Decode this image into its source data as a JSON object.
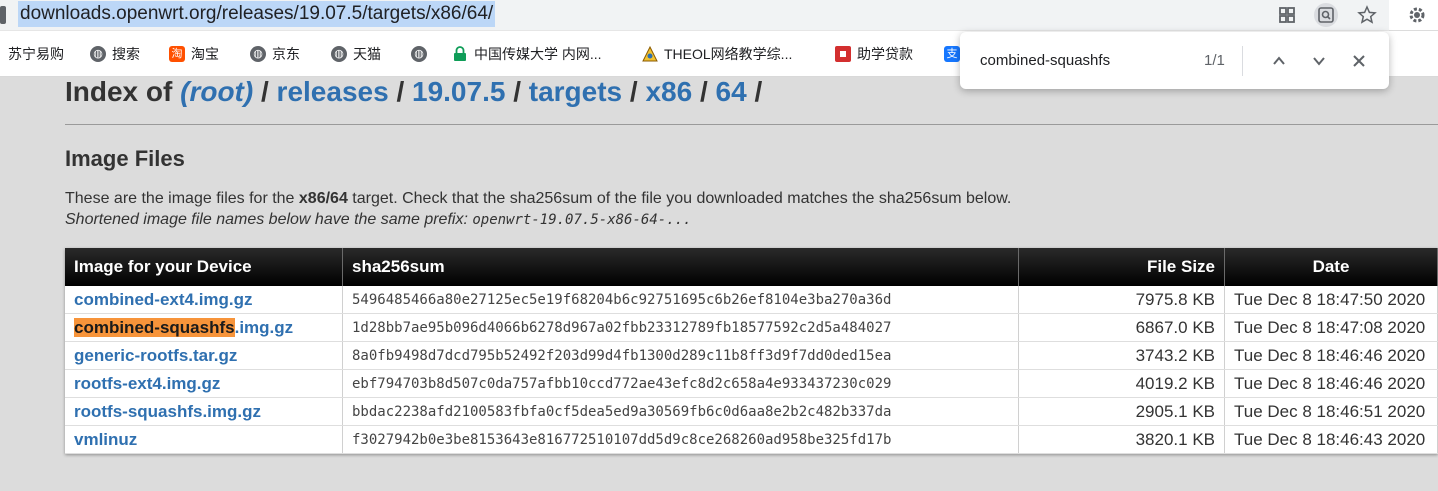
{
  "browser": {
    "url": "downloads.openwrt.org/releases/19.07.5/targets/x86/64/",
    "icons": [
      "apps-grid-icon",
      "lens-icon",
      "star-icon",
      "settings-gear-icon"
    ]
  },
  "bookmarks": [
    {
      "label": "苏宁易购",
      "icon": "none"
    },
    {
      "label": "搜索",
      "icon": "globe-icon"
    },
    {
      "label": "淘宝",
      "icon": "taobao-icon"
    },
    {
      "label": "京东",
      "icon": "globe-icon"
    },
    {
      "label": "天猫",
      "icon": "globe-icon"
    },
    {
      "label": "",
      "icon": "globe-icon"
    },
    {
      "label": "中国传媒大学 内网...",
      "icon": "lock-icon"
    },
    {
      "label": "THEOL网络教学综...",
      "icon": "theol-icon"
    },
    {
      "label": "助学贷款",
      "icon": "loan-icon"
    }
  ],
  "page": {
    "index_prefix": "Index of",
    "breadcrumb": [
      "(root)",
      "releases",
      "19.07.5",
      "targets",
      "x86",
      "64"
    ],
    "separator": "/",
    "section_title": "Image Files",
    "desc_part1": "These are the image files for the ",
    "desc_target": "x86/64",
    "desc_part2": " target. Check that the sha256sum of the file you downloaded matches the sha256sum below.",
    "prefix_note": "Shortened image file names below have the same prefix: ",
    "prefix_value": "openwrt-19.07.5-x86-64-..."
  },
  "table": {
    "headers": [
      "Image for your Device",
      "sha256sum",
      "File Size",
      "Date"
    ],
    "rows": [
      {
        "name": "combined-ext4.img.gz",
        "sha": "5496485466a80e27125ec5e19f68204b6c92751695c6b26ef8104e3ba270a36d",
        "size": "7975.8 KB",
        "date": "Tue Dec 8 18:47:50 2020"
      },
      {
        "name_highlight": "combined-squashfs",
        "name_rest": ".img.gz",
        "sha": "1d28bb7ae95b096d4066b6278d967a02fbb23312789fb18577592c2d5a484027",
        "size": "6867.0 KB",
        "date": "Tue Dec 8 18:47:08 2020"
      },
      {
        "name": "generic-rootfs.tar.gz",
        "sha": "8a0fb9498d7dcd795b52492f203d99d4fb1300d289c11b8ff3d9f7dd0ded15ea",
        "size": "3743.2 KB",
        "date": "Tue Dec 8 18:46:46 2020"
      },
      {
        "name": "rootfs-ext4.img.gz",
        "sha": "ebf794703b8d507c0da757afbb10ccd772ae43efc8d2c658a4e933437230c029",
        "size": "4019.2 KB",
        "date": "Tue Dec 8 18:46:46 2020"
      },
      {
        "name": "rootfs-squashfs.img.gz",
        "sha": "bbdac2238afd2100583fbfa0cf5dea5ed9a30569fb6c0d6aa8e2b2c482b337da",
        "size": "2905.1 KB",
        "date": "Tue Dec 8 18:46:51 2020"
      },
      {
        "name": "vmlinuz",
        "sha": "f3027942b0e3be8153643e816772510107dd5d9c8ce268260ad958be325fd17b",
        "size": "3820.1 KB",
        "date": "Tue Dec 8 18:46:43 2020"
      }
    ]
  },
  "findbar": {
    "query": "combined-squashfs",
    "count": "1/1"
  },
  "colors": {
    "link": "#2f70b0",
    "highlight": "#f7943a",
    "header_bg": "#000000",
    "page_bg": "#dcdcdc"
  }
}
